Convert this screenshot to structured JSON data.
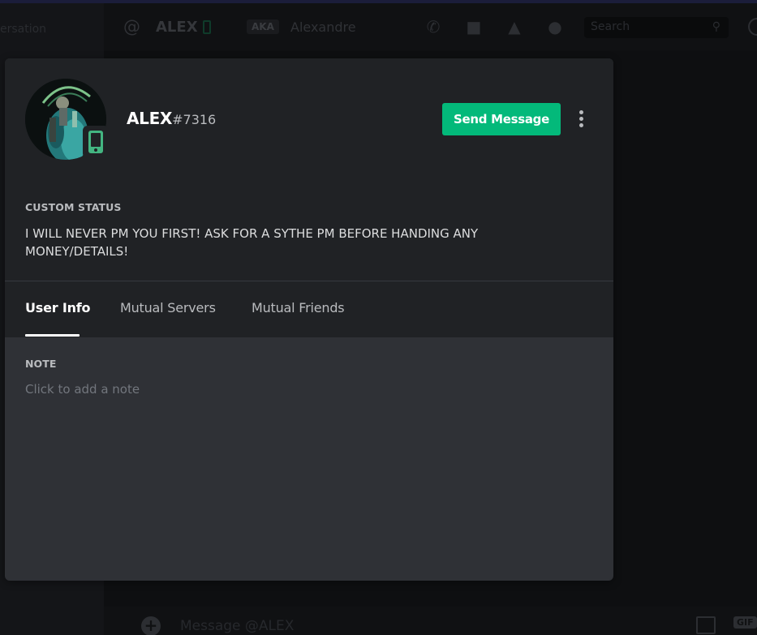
{
  "background": {
    "sidebar_fragment": "ersation",
    "header": {
      "at_symbol": "@",
      "username": "ALEX",
      "aka_badge": "AKA",
      "nickname": "Alexandre",
      "search_placeholder": "Search",
      "icons": [
        "phone-call-icon",
        "video-call-icon",
        "pin-icon",
        "add-friend-icon",
        "search-icon",
        "help-icon"
      ]
    },
    "composer": {
      "placeholder": "Message @ALEX",
      "gif_label": "GIF"
    }
  },
  "profile": {
    "username": "ALEX",
    "discriminator": "#7316",
    "status_icon": "mobile-online-icon",
    "send_message_label": "Send Message",
    "custom_status": {
      "title": "CUSTOM STATUS",
      "text": "I WILL NEVER PM YOU FIRST! ASK FOR A SYTHE PM BEFORE HANDING ANY MONEY/DETAILS!"
    },
    "tabs": [
      {
        "label": "User Info",
        "active": true
      },
      {
        "label": "Mutual Servers",
        "active": false
      },
      {
        "label": "Mutual Friends",
        "active": false
      }
    ],
    "note": {
      "title": "NOTE",
      "placeholder": "Click to add a note"
    }
  },
  "colors": {
    "accent_green": "#03b97a",
    "modal_header": "#202225",
    "modal_body": "#2f3136",
    "online_green": "#43b581"
  }
}
